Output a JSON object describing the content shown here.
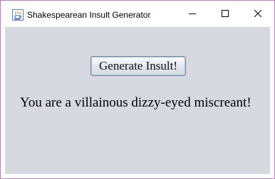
{
  "window": {
    "title": "Shakespearean Insult Generator",
    "icon": "java-cup-icon"
  },
  "controls": {
    "minimize_icon": "minimize-icon",
    "maximize_icon": "maximize-icon",
    "close_icon": "close-icon"
  },
  "main": {
    "button_label": "Generate Insult!",
    "insult": "You are a villainous dizzy-eyed miscreant!"
  },
  "colors": {
    "content_background": "#d6d9df",
    "window_border": "#b57fb8"
  }
}
